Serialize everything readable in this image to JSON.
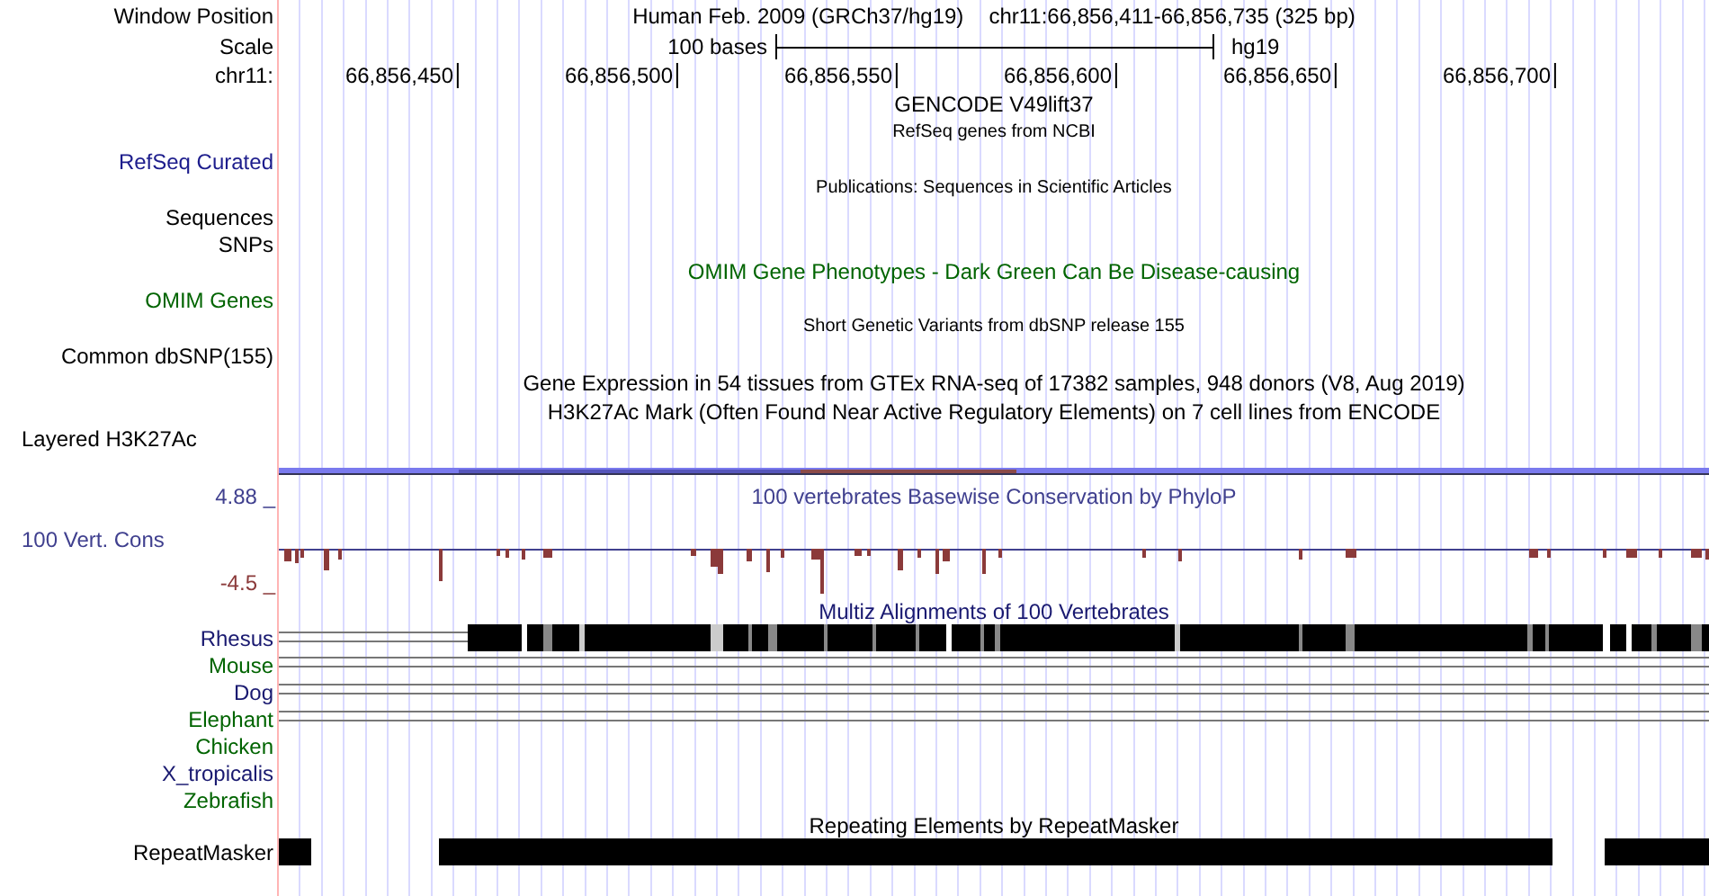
{
  "header": {
    "label": "Window Position",
    "assembly": "Human Feb. 2009 (GRCh37/hg19)",
    "position": "chr11:66,856,411-66,856,735 (325 bp)"
  },
  "scale": {
    "label": "Scale",
    "length": "100 bases",
    "assembly": "hg19"
  },
  "ruler": {
    "label": "chr11:",
    "ticks": [
      "66,856,450",
      "66,856,500",
      "66,856,550",
      "66,856,600",
      "66,856,650",
      "66,856,700"
    ]
  },
  "rows": [
    {
      "kind": "title",
      "text": "GENCODE V49lift37",
      "color": "#000000"
    },
    {
      "kind": "note",
      "text": "RefSeq genes from NCBI",
      "color": "#000000"
    },
    {
      "kind": "label",
      "text": "RefSeq Curated",
      "color": "#1c1c8c"
    },
    {
      "kind": "note",
      "text": "Publications: Sequences in Scientific Articles",
      "color": "#000000"
    },
    {
      "kind": "label",
      "text": "Sequences",
      "color": "#000000"
    },
    {
      "kind": "label",
      "text": "SNPs",
      "color": "#000000"
    },
    {
      "kind": "title",
      "text": "OMIM Gene Phenotypes - Dark Green Can Be Disease-causing",
      "color": "#006400"
    },
    {
      "kind": "label",
      "text": "OMIM Genes",
      "color": "#006400"
    },
    {
      "kind": "note",
      "text": "Short Genetic Variants from dbSNP release 155",
      "color": "#000000"
    },
    {
      "kind": "label",
      "text": "Common dbSNP(155)",
      "color": "#000000"
    },
    {
      "kind": "title",
      "text": "Gene Expression in 54 tissues from GTEx RNA-seq of 17382 samples, 948 donors (V8, Aug 2019)",
      "color": "#000000"
    },
    {
      "kind": "title",
      "text": "H3K27Ac Mark (Often Found Near Active Regulatory Elements) on 7 cell lines from ENCODE",
      "color": "#000000"
    },
    {
      "kind": "label_left",
      "text": "Layered H3K27Ac",
      "color": "#000000"
    }
  ],
  "conservation": {
    "title": "100 vertebrates Basewise Conservation by PhyloP",
    "label": "100 Vert. Cons",
    "max": "4.88 _",
    "min": "-4.5 _"
  },
  "alignments": {
    "title": "Multiz Alignments of 100 Vertebrates",
    "species": [
      {
        "name": "Rhesus",
        "color": "#191970",
        "kind": "blocks"
      },
      {
        "name": "Mouse",
        "color": "#006400",
        "kind": "lines"
      },
      {
        "name": "Dog",
        "color": "#191970",
        "kind": "lines"
      },
      {
        "name": "Elephant",
        "color": "#006400",
        "kind": "lines"
      },
      {
        "name": "Chicken",
        "color": "#006400",
        "kind": "empty"
      },
      {
        "name": "X_tropicalis",
        "color": "#191970",
        "kind": "empty"
      },
      {
        "name": "Zebrafish",
        "color": "#006400",
        "kind": "empty"
      }
    ]
  },
  "repeats": {
    "title": "Repeating Elements by RepeatMasker",
    "label": "RepeatMasker"
  }
}
